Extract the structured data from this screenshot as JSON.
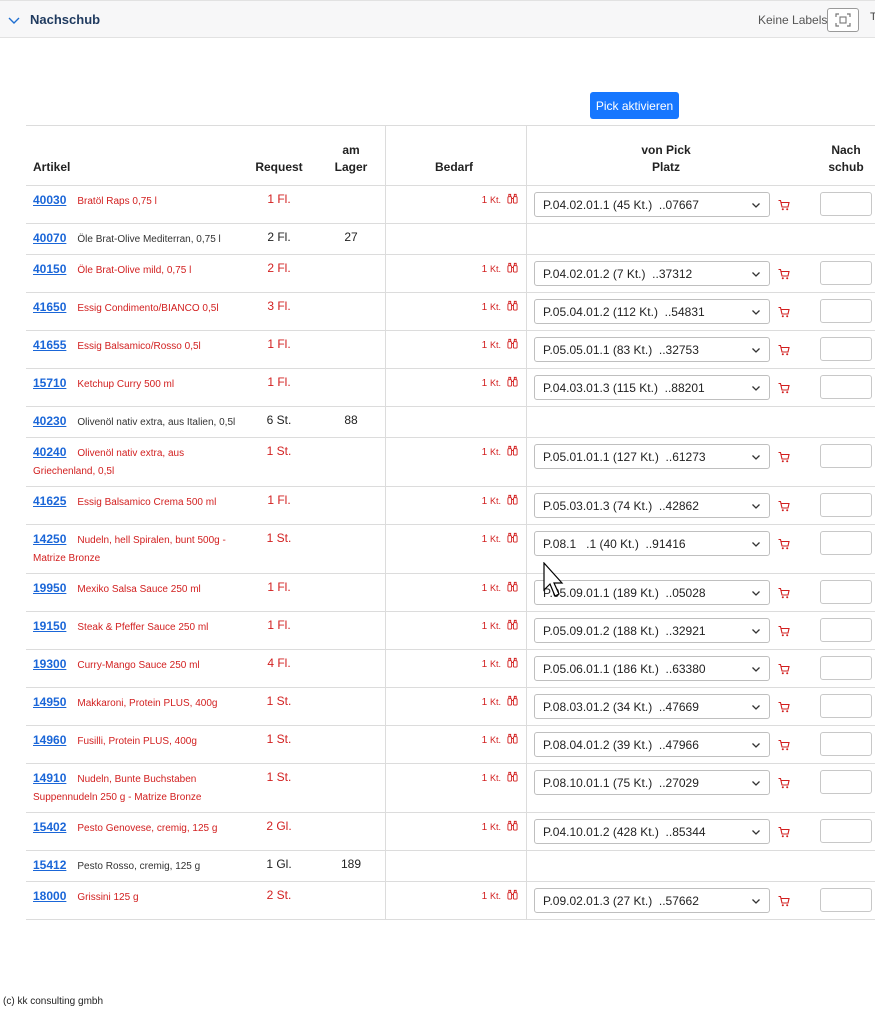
{
  "header": {
    "title": "Nachschub",
    "labels_text": "Keine Labels",
    "edge_glyph": "T"
  },
  "toolbar": {
    "pick_label": "Pick aktivieren"
  },
  "table": {
    "col_artikel": "Artikel",
    "col_request": "Request",
    "col_lager_line1": "am",
    "col_lager_line2": "Lager",
    "col_bedarf": "Bedarf",
    "col_von_line1": "von Pick",
    "col_von_line2": "Platz",
    "col_nach_line1": "Nach",
    "col_nach_line2": "schub",
    "rows": [
      {
        "no": "40030",
        "name": "Bratöl Raps 0,75 l",
        "req": "1 Fl.",
        "lager": "",
        "bed_num": "1",
        "bed_unit": "Kt.",
        "von": "P.04.02.01.1 (45 Kt.)  ..07667",
        "red": true
      },
      {
        "no": "40070",
        "name": "Öle Brat-Olive Mediterran, 0,75 l",
        "req": "2 Fl.",
        "lager": "27",
        "bed_num": "",
        "bed_unit": "",
        "von": "",
        "red": false
      },
      {
        "no": "40150",
        "name": "Öle Brat-Olive mild, 0,75 l",
        "req": "2 Fl.",
        "lager": "",
        "bed_num": "1",
        "bed_unit": "Kt.",
        "von": "P.04.02.01.2 (7 Kt.)  ..37312",
        "red": true
      },
      {
        "no": "41650",
        "name": "Essig Condimento/BIANCO 0,5l",
        "req": "3 Fl.",
        "lager": "",
        "bed_num": "1",
        "bed_unit": "Kt.",
        "von": "P.05.04.01.2 (112 Kt.)  ..54831",
        "red": true
      },
      {
        "no": "41655",
        "name": "Essig Balsamico/Rosso 0,5l",
        "req": "1 Fl.",
        "lager": "",
        "bed_num": "1",
        "bed_unit": "Kt.",
        "von": "P.05.05.01.1 (83 Kt.)  ..32753",
        "red": true
      },
      {
        "no": "15710",
        "name": "Ketchup Curry 500 ml",
        "req": "1 Fl.",
        "lager": "",
        "bed_num": "1",
        "bed_unit": "Kt.",
        "von": "P.04.03.01.3 (115 Kt.)  ..88201",
        "red": true
      },
      {
        "no": "40230",
        "name": "Olivenöl nativ extra, aus Italien, 0,5l",
        "req": "6 St.",
        "lager": "88",
        "bed_num": "",
        "bed_unit": "",
        "von": "",
        "red": false
      },
      {
        "no": "40240",
        "name": "Olivenöl nativ extra, aus Griechenland, 0,5l",
        "req": "1 St.",
        "lager": "",
        "bed_num": "1",
        "bed_unit": "Kt.",
        "von": "P.05.01.01.1 (127 Kt.)  ..61273",
        "red": true
      },
      {
        "no": "41625",
        "name": "Essig Balsamico Crema 500 ml",
        "req": "1 Fl.",
        "lager": "",
        "bed_num": "1",
        "bed_unit": "Kt.",
        "von": "P.05.03.01.3 (74 Kt.)  ..42862",
        "red": true
      },
      {
        "no": "14250",
        "name": "Nudeln, hell Spiralen, bunt 500g - Matrize Bronze",
        "req": "1 St.",
        "lager": "",
        "bed_num": "1",
        "bed_unit": "Kt.",
        "von": "P.08.1   .1 (40 Kt.)  ..91416",
        "red": true
      },
      {
        "no": "19950",
        "name": "Mexiko Salsa Sauce 250 ml",
        "req": "1 Fl.",
        "lager": "",
        "bed_num": "1",
        "bed_unit": "Kt.",
        "von": "P.05.09.01.1 (189 Kt.)  ..05028",
        "red": true
      },
      {
        "no": "19150",
        "name": "Steak & Pfeffer Sauce 250 ml",
        "req": "1 Fl.",
        "lager": "",
        "bed_num": "1",
        "bed_unit": "Kt.",
        "von": "P.05.09.01.2 (188 Kt.)  ..32921",
        "red": true
      },
      {
        "no": "19300",
        "name": "Curry-Mango Sauce 250 ml",
        "req": "4 Fl.",
        "lager": "",
        "bed_num": "1",
        "bed_unit": "Kt.",
        "von": "P.05.06.01.1 (186 Kt.)  ..63380",
        "red": true
      },
      {
        "no": "14950",
        "name": "Makkaroni, Protein PLUS, 400g",
        "req": "1 St.",
        "lager": "",
        "bed_num": "1",
        "bed_unit": "Kt.",
        "von": "P.08.03.01.2 (34 Kt.)  ..47669",
        "red": true
      },
      {
        "no": "14960",
        "name": "Fusilli, Protein PLUS, 400g",
        "req": "1 St.",
        "lager": "",
        "bed_num": "1",
        "bed_unit": "Kt.",
        "von": "P.08.04.01.2 (39 Kt.)  ..47966",
        "red": true
      },
      {
        "no": "14910",
        "name": "Nudeln, Bunte Buchstaben Suppennudeln 250 g - Matrize Bronze",
        "req": "1 St.",
        "lager": "",
        "bed_num": "1",
        "bed_unit": "Kt.",
        "von": "P.08.10.01.1 (75 Kt.)  ..27029",
        "red": true
      },
      {
        "no": "15402",
        "name": "Pesto Genovese, cremig, 125 g",
        "req": "2 Gl.",
        "lager": "",
        "bed_num": "1",
        "bed_unit": "Kt.",
        "von": "P.04.10.01.2 (428 Kt.)  ..85344",
        "red": true
      },
      {
        "no": "15412",
        "name": "Pesto Rosso, cremig, 125 g",
        "req": "1 Gl.",
        "lager": "189",
        "bed_num": "",
        "bed_unit": "",
        "von": "",
        "red": false
      },
      {
        "no": "18000",
        "name": "Grissini 125 g",
        "req": "2 St.",
        "lager": "",
        "bed_num": "1",
        "bed_unit": "Kt.",
        "von": "P.09.02.01.3 (27 Kt.)  ..57662",
        "red": true
      }
    ]
  },
  "footer": {
    "copyright": "(c) kk consulting gmbh"
  },
  "icons": {
    "collapse": "chevron-down-icon",
    "labels": "scan-frame-icon",
    "bedarf": "binoculars-icon",
    "select": "chevron-down-icon",
    "cart": "shopping-cart-icon",
    "pointer": "mouse-cursor-icon"
  },
  "colors": {
    "accent": "#1677ff",
    "link": "#1a66d8",
    "alert": "#d21f1f",
    "header_title": "#1f3a5f"
  }
}
